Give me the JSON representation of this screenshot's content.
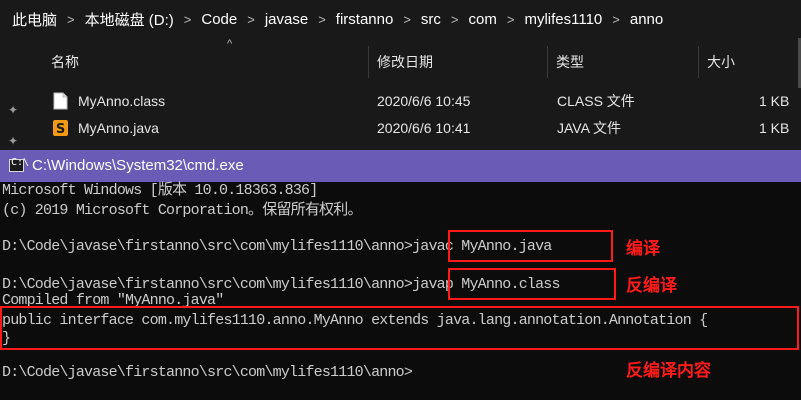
{
  "explorer": {
    "breadcrumbs": [
      "此电脑",
      "本地磁盘 (D:)",
      "Code",
      "javase",
      "firstanno",
      "src",
      "com",
      "mylifes1110",
      "anno"
    ],
    "separator": ">",
    "columns": {
      "name": "名称",
      "modified": "修改日期",
      "type": "类型",
      "size": "大小"
    },
    "files": [
      {
        "name": "MyAnno.class",
        "modified": "2020/6/6 10:45",
        "type": "CLASS 文件",
        "size": "1 KB",
        "icon": "class-file-icon"
      },
      {
        "name": "MyAnno.java",
        "modified": "2020/6/6 10:41",
        "type": "JAVA 文件",
        "size": "1 KB",
        "icon": "java-file-icon"
      }
    ]
  },
  "cmd": {
    "title": "C:\\Windows\\System32\\cmd.exe",
    "lines": [
      "Microsoft Windows [版本 10.0.18363.836]",
      "(c) 2019 Microsoft Corporation。保留所有权利。",
      "",
      "D:\\Code\\javase\\firstanno\\src\\com\\mylifes1110\\anno>javac MyAnno.java",
      "",
      "D:\\Code\\javase\\firstanno\\src\\com\\mylifes1110\\anno>javap MyAnno.class",
      "Compiled from \"MyAnno.java\"",
      "public interface com.mylifes1110.anno.MyAnno extends java.lang.annotation.Annotation {",
      "}",
      "",
      "D:\\Code\\javase\\firstanno\\src\\com\\mylifes1110\\anno>"
    ]
  },
  "annotations": {
    "compile": "编译",
    "decompile": "反编译",
    "decompile_content": "反编译内容"
  },
  "colors": {
    "highlight": "#ff1a1a",
    "cmd_titlebar": "#6a5bb6"
  }
}
